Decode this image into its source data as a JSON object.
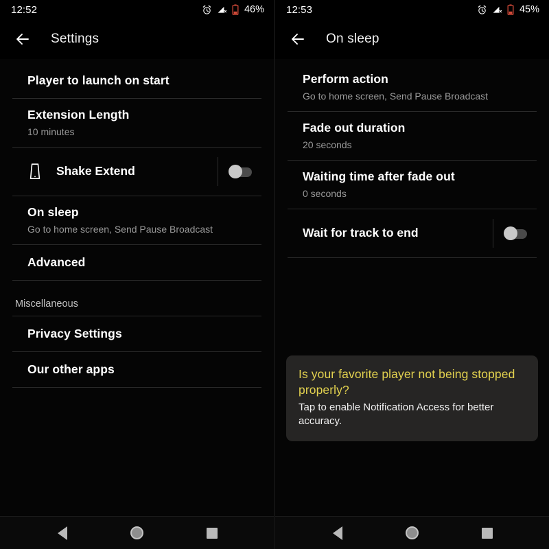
{
  "left": {
    "statusbar": {
      "time": "12:52",
      "battery_percent": "46%",
      "icons": [
        "alarm-icon",
        "signal-off-icon",
        "battery-low-icon"
      ]
    },
    "appbar": {
      "back_icon": "arrow-back-icon",
      "title": "Settings"
    },
    "rows": [
      {
        "title": "Player to launch on start",
        "sub": "",
        "type": "plain"
      },
      {
        "title": "Extension Length",
        "sub": "10 minutes",
        "type": "plain"
      },
      {
        "title": "Shake Extend",
        "sub": "",
        "type": "switch",
        "icon": "phone-shake-icon",
        "checked": false
      },
      {
        "title": "On sleep",
        "sub": "Go to home screen, Send Pause Broadcast",
        "type": "plain"
      },
      {
        "title": "Advanced",
        "sub": "",
        "type": "plain"
      }
    ],
    "section_header": "Miscellaneous",
    "rows2": [
      {
        "title": "Privacy Settings",
        "sub": "",
        "type": "plain"
      },
      {
        "title": "Our other apps",
        "sub": "",
        "type": "plain"
      }
    ]
  },
  "right": {
    "statusbar": {
      "time": "12:53",
      "battery_percent": "45%",
      "icons": [
        "alarm-icon",
        "signal-off-icon",
        "battery-low-icon"
      ]
    },
    "appbar": {
      "back_icon": "arrow-back-icon",
      "title": "On sleep"
    },
    "rows": [
      {
        "title": "Perform action",
        "sub": "Go to home screen, Send Pause Broadcast",
        "type": "plain"
      },
      {
        "title": "Fade out duration",
        "sub": "20 seconds",
        "type": "plain"
      },
      {
        "title": "Waiting time after fade out",
        "sub": "0 seconds",
        "type": "plain"
      },
      {
        "title": "Wait for track to end",
        "sub": "",
        "type": "switch",
        "icon": "",
        "checked": false
      }
    ],
    "card": {
      "title": "Is your favorite player not being stopped properly?",
      "body": "Tap to enable Notification Access for better accuracy."
    }
  },
  "navbar": {
    "back": "nav-back-icon",
    "home": "nav-home-icon",
    "recents": "nav-recents-icon"
  },
  "colors": {
    "background": "#050505",
    "row_title": "#ffffff",
    "row_subtitle": "#9a9a9a",
    "divider": "#2a2a2a",
    "card_background": "#262524",
    "card_title": "#e3d24f",
    "battery_warning": "#d64b3a",
    "switch_thumb_off": "#c9c9c9",
    "switch_track_off": "#4a4a4a"
  }
}
